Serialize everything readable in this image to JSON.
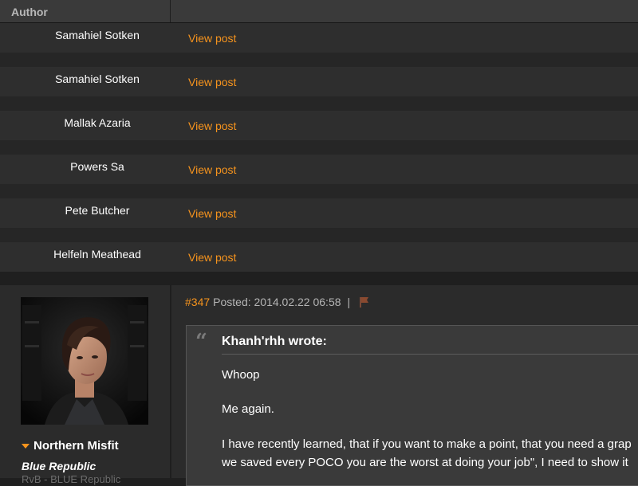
{
  "header": {
    "author_label": "Author"
  },
  "rows": [
    {
      "author": "Samahiel Sotken",
      "link": "View post"
    },
    {
      "author": "Samahiel Sotken",
      "link": "View post"
    },
    {
      "author": "Mallak Azaria",
      "link": "View post"
    },
    {
      "author": "Powers Sa",
      "link": "View post"
    },
    {
      "author": "Pete Butcher",
      "link": "View post"
    },
    {
      "author": "Helfeln Meathead",
      "link": "View post"
    }
  ],
  "post": {
    "number": "#347",
    "posted": "Posted: 2014.02.22 06:58",
    "separator": "|",
    "author": {
      "name": "Northern Misfit",
      "corp": "Blue Republic",
      "alliance": "RvB - BLUE Republic"
    },
    "quote": {
      "author": "Khanh'rhh wrote:",
      "lines": [
        "Whoop",
        "Me again.",
        "I have recently learned, that if you want to make a point, that you need a grap",
        "we saved every POCO you are the worst at doing your job\", I need to show it"
      ]
    }
  },
  "colors": {
    "accent": "#f7941d",
    "background": "#1f1f1f",
    "row": "#2e2e2e"
  }
}
